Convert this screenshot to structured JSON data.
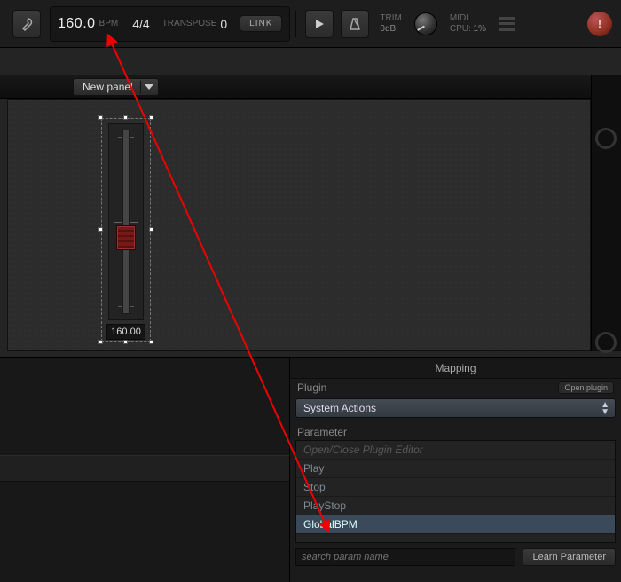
{
  "topbar": {
    "tempo": "160.0",
    "bpm_label": "BPM",
    "timesig": "4/4",
    "transpose_label": "TRANSPOSE",
    "transpose_value": "0",
    "link_label": "LINK",
    "trim_label": "TRIM",
    "trim_value": "0dB",
    "midi_label": "MIDI",
    "cpu_label": "CPU:",
    "cpu_value": "1%"
  },
  "panel": {
    "dropdown_label": "New panel"
  },
  "slider": {
    "value": "160.00"
  },
  "mapping": {
    "title": "Mapping",
    "plugin_label": "Plugin",
    "open_plugin": "Open plugin",
    "plugin_value": "System Actions",
    "parameter_label": "Parameter",
    "params": [
      {
        "label": "Open/Close Plugin Editor",
        "state": "dim"
      },
      {
        "label": "Play",
        "state": ""
      },
      {
        "label": "Stop",
        "state": ""
      },
      {
        "label": "PlayStop",
        "state": ""
      },
      {
        "label": "GlobalBPM",
        "state": "selected"
      }
    ],
    "search_placeholder": "search param name",
    "learn_label": "Learn Parameter"
  }
}
